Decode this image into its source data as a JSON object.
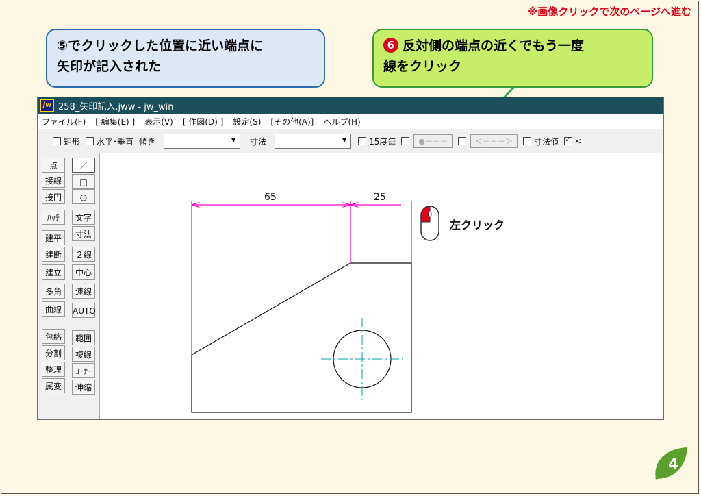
{
  "top_note": "※画像クリックで次のページへ進む",
  "bubble1": {
    "line1": "⑤でクリックした位置に近い端点に",
    "line2": "矢印が記入された"
  },
  "bubble2": {
    "number": "6",
    "line1": "反対側の端点の近くでもう一度",
    "line2": "線をクリック"
  },
  "window": {
    "logo": "jw",
    "title": "258_矢印記入.jww - jw_win",
    "menu": [
      "ファイル(F)",
      "[ 編集(E) ]",
      "表示(V)",
      "[ 作図(D) ]",
      "設定(S)",
      "[その他(A)]",
      "ヘルプ(H)"
    ],
    "toolbar": {
      "rect_label": "矩形",
      "hv_label": "水平･垂直",
      "tilt_label": "傾き",
      "dim_label": "寸法",
      "deg15_label": "15度毎",
      "btn1": "●－－－",
      "btn2": "＜－－－＞",
      "dimval_label": "寸法値",
      "last_label": "<"
    },
    "left_tools": [
      "点",
      "接線",
      "接円",
      "ﾊｯﾁ",
      "建平",
      "建断",
      "建立",
      "多角形",
      "曲線",
      "包絡",
      "分割",
      "整理",
      "属変"
    ],
    "right_tools": [
      "／",
      "□",
      "○",
      "文字",
      "寸法",
      "２線",
      "中心線",
      "連線",
      "AUTO",
      "範囲",
      "複線",
      "ｺｰﾅｰ",
      "伸縮"
    ]
  },
  "drawing": {
    "dim1": "65",
    "dim2": "25"
  },
  "mouse_label": "左クリック",
  "page_number": "4",
  "colors": {
    "accent_red": "#e0001a",
    "dim_magenta": "#ff00c8",
    "center_cyan": "#00a0a0",
    "titlebar": "#1d4e5b"
  }
}
